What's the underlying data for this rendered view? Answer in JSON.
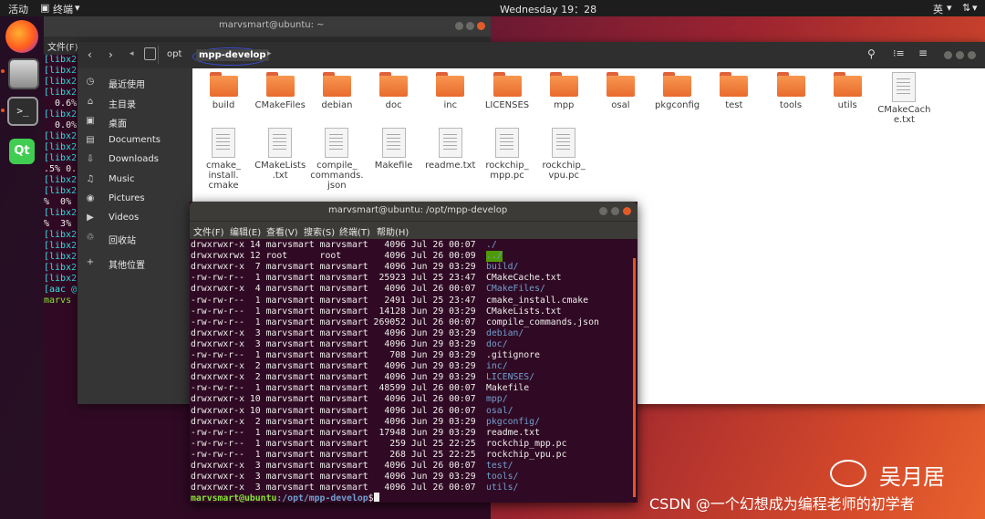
{
  "topbar": {
    "activities": "活动",
    "app": "终端",
    "clock": "Wednesday 19：28",
    "input_method": "英"
  },
  "background_terminal": {
    "title": "marvsmart@ubuntu: ~",
    "menu": [
      "文件(F)",
      "编辑(E)",
      "查看(V)",
      "搜索(S)",
      "终端(T)",
      "帮助(H)"
    ],
    "lines": [
      "[libx2",
      "[libx2",
      "[libx2",
      "[libx2",
      "  0.6%",
      "[libx2",
      "  0.0%",
      "[libx2",
      "[libx2",
      "[libx2",
      ".5% 0.",
      "[libx2",
      "[libx2",
      "%  0%",
      "[libx2",
      "%  3%",
      "[libx2",
      "[libx2",
      "[libx2",
      "[libx2",
      "[libx2",
      "[aac @",
      "marvs"
    ]
  },
  "file_manager": {
    "path": [
      "opt",
      "mpp-develop"
    ],
    "sidebar": [
      {
        "icon": "clock-icon",
        "label": "最近使用"
      },
      {
        "icon": "home-icon",
        "label": "主目录"
      },
      {
        "icon": "desktop-icon",
        "label": "桌面"
      },
      {
        "icon": "document-icon",
        "label": "Documents"
      },
      {
        "icon": "download-icon",
        "label": "Downloads"
      },
      {
        "icon": "music-icon",
        "label": "Music"
      },
      {
        "icon": "camera-icon",
        "label": "Pictures"
      },
      {
        "icon": "video-icon",
        "label": "Videos"
      },
      {
        "icon": "trash-icon",
        "label": "回收站"
      },
      {
        "icon": "plus-icon",
        "label": "其他位置"
      }
    ],
    "items": [
      {
        "name": "build",
        "kind": "folder"
      },
      {
        "name": "CMakeFiles",
        "kind": "folder"
      },
      {
        "name": "debian",
        "kind": "folder"
      },
      {
        "name": "doc",
        "kind": "folder"
      },
      {
        "name": "inc",
        "kind": "folder"
      },
      {
        "name": "LICENSES",
        "kind": "folder"
      },
      {
        "name": "mpp",
        "kind": "folder"
      },
      {
        "name": "osal",
        "kind": "folder"
      },
      {
        "name": "pkgconfig",
        "kind": "folder"
      },
      {
        "name": "test",
        "kind": "folder"
      },
      {
        "name": "tools",
        "kind": "folder"
      },
      {
        "name": "utils",
        "kind": "folder"
      },
      {
        "name": "CMakeCach\ne.txt",
        "kind": "file"
      },
      {
        "name": "cmake_\ninstall.\ncmake",
        "kind": "file"
      },
      {
        "name": "CMakeLists\n.txt",
        "kind": "file"
      },
      {
        "name": "compile_\ncommands.\njson",
        "kind": "file"
      },
      {
        "name": "Makefile",
        "kind": "file"
      },
      {
        "name": "readme.txt",
        "kind": "file"
      },
      {
        "name": "rockchip_\nmpp.pc",
        "kind": "file"
      },
      {
        "name": "rockchip_\nvpu.pc",
        "kind": "file"
      }
    ]
  },
  "terminal": {
    "title": "marvsmart@ubuntu: /opt/mpp-develop",
    "menu": [
      "文件(F)",
      "编辑(E)",
      "查看(V)",
      "搜索(S)",
      "终端(T)",
      "帮助(H)"
    ],
    "lines": [
      {
        "meta": "drwxrwxr-x 14 marvsmart marvsmart   4096 Jul 26 00:07",
        "name": "./",
        "type": "dir"
      },
      {
        "meta": "drwxrwxrwx 12 root      root        4096 Jul 26 00:09",
        "name": "../",
        "type": "hl"
      },
      {
        "meta": "drwxrwxr-x  7 marvsmart marvsmart   4096 Jun 29 03:29",
        "name": "build/",
        "type": "dir"
      },
      {
        "meta": "-rw-rw-r--  1 marvsmart marvsmart  25923 Jul 25 23:47",
        "name": "CMakeCache.txt",
        "type": "file"
      },
      {
        "meta": "drwxrwxr-x  4 marvsmart marvsmart   4096 Jul 26 00:07",
        "name": "CMakeFiles/",
        "type": "dir"
      },
      {
        "meta": "-rw-rw-r--  1 marvsmart marvsmart   2491 Jul 25 23:47",
        "name": "cmake_install.cmake",
        "type": "file"
      },
      {
        "meta": "-rw-rw-r--  1 marvsmart marvsmart  14128 Jun 29 03:29",
        "name": "CMakeLists.txt",
        "type": "file"
      },
      {
        "meta": "-rw-rw-r--  1 marvsmart marvsmart 269052 Jul 26 00:07",
        "name": "compile_commands.json",
        "type": "file"
      },
      {
        "meta": "drwxrwxr-x  3 marvsmart marvsmart   4096 Jun 29 03:29",
        "name": "debian/",
        "type": "dir"
      },
      {
        "meta": "drwxrwxr-x  3 marvsmart marvsmart   4096 Jun 29 03:29",
        "name": "doc/",
        "type": "dir"
      },
      {
        "meta": "-rw-rw-r--  1 marvsmart marvsmart    708 Jun 29 03:29",
        "name": ".gitignore",
        "type": "file"
      },
      {
        "meta": "drwxrwxr-x  2 marvsmart marvsmart   4096 Jun 29 03:29",
        "name": "inc/",
        "type": "dir"
      },
      {
        "meta": "drwxrwxr-x  2 marvsmart marvsmart   4096 Jun 29 03:29",
        "name": "LICENSES/",
        "type": "dir"
      },
      {
        "meta": "-rw-rw-r--  1 marvsmart marvsmart  48599 Jul 26 00:07",
        "name": "Makefile",
        "type": "file"
      },
      {
        "meta": "drwxrwxr-x 10 marvsmart marvsmart   4096 Jul 26 00:07",
        "name": "mpp/",
        "type": "dir"
      },
      {
        "meta": "drwxrwxr-x 10 marvsmart marvsmart   4096 Jul 26 00:07",
        "name": "osal/",
        "type": "dir"
      },
      {
        "meta": "drwxrwxr-x  2 marvsmart marvsmart   4096 Jun 29 03:29",
        "name": "pkgconfig/",
        "type": "dir"
      },
      {
        "meta": "-rw-rw-r--  1 marvsmart marvsmart  17948 Jun 29 03:29",
        "name": "readme.txt",
        "type": "file"
      },
      {
        "meta": "-rw-rw-r--  1 marvsmart marvsmart    259 Jul 25 22:25",
        "name": "rockchip_mpp.pc",
        "type": "file"
      },
      {
        "meta": "-rw-rw-r--  1 marvsmart marvsmart    268 Jul 25 22:25",
        "name": "rockchip_vpu.pc",
        "type": "file"
      },
      {
        "meta": "drwxrwxr-x  3 marvsmart marvsmart   4096 Jul 26 00:07",
        "name": "test/",
        "type": "dir"
      },
      {
        "meta": "drwxrwxr-x  3 marvsmart marvsmart   4096 Jun 29 03:29",
        "name": "tools/",
        "type": "dir"
      },
      {
        "meta": "drwxrwxr-x  3 marvsmart marvsmart   4096 Jul 26 00:07",
        "name": "utils/",
        "type": "dir"
      }
    ],
    "prompt_user": "marvsmart@ubuntu",
    "prompt_path": ":/opt/mpp-develop",
    "prompt_symbol": "$"
  },
  "watermark": {
    "brand": "吴月居",
    "csdn": "CSDN @一个幻想成为编程老师的初学者"
  }
}
